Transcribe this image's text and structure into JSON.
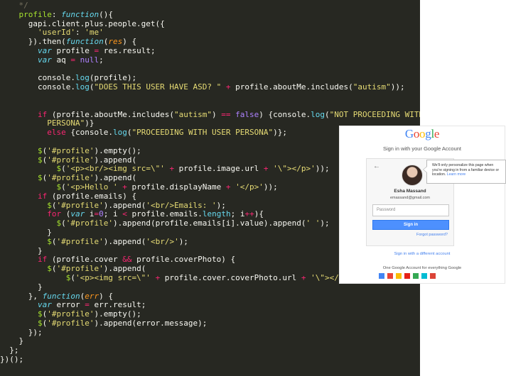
{
  "editor": {
    "lines": [
      [
        {
          "t": "    */",
          "c": "c"
        }
      ],
      [
        {
          "t": "    ",
          "c": ""
        },
        {
          "t": "profile",
          "c": "fn"
        },
        {
          "t": ": ",
          "c": ""
        },
        {
          "t": "function",
          "c": "f"
        },
        {
          "t": "(){",
          "c": ""
        }
      ],
      [
        {
          "t": "      gapi.client.plus.people.get({",
          "c": ""
        }
      ],
      [
        {
          "t": "        ",
          "c": ""
        },
        {
          "t": "'userId'",
          "c": "s"
        },
        {
          "t": ": ",
          "c": ""
        },
        {
          "t": "'me'",
          "c": "s"
        }
      ],
      [
        {
          "t": "      }).then(",
          "c": ""
        },
        {
          "t": "function",
          "c": "f"
        },
        {
          "t": "(",
          "c": ""
        },
        {
          "t": "res",
          "c": "p"
        },
        {
          "t": ") {",
          "c": ""
        }
      ],
      [
        {
          "t": "        ",
          "c": ""
        },
        {
          "t": "var",
          "c": "f"
        },
        {
          "t": " profile ",
          "c": ""
        },
        {
          "t": "=",
          "c": "k"
        },
        {
          "t": " res.result;",
          "c": ""
        }
      ],
      [
        {
          "t": "        ",
          "c": ""
        },
        {
          "t": "var",
          "c": "f"
        },
        {
          "t": " aq ",
          "c": ""
        },
        {
          "t": "=",
          "c": "k"
        },
        {
          "t": " ",
          "c": ""
        },
        {
          "t": "null",
          "c": "n"
        },
        {
          "t": ";",
          "c": ""
        }
      ],
      [
        {
          "t": "",
          "c": ""
        }
      ],
      [
        {
          "t": "        console.",
          "c": ""
        },
        {
          "t": "log",
          "c": "b"
        },
        {
          "t": "(profile);",
          "c": ""
        }
      ],
      [
        {
          "t": "        console.",
          "c": ""
        },
        {
          "t": "log",
          "c": "b"
        },
        {
          "t": "(",
          "c": ""
        },
        {
          "t": "\"DOES THIS USER HAVE ASD? \"",
          "c": "s"
        },
        {
          "t": " ",
          "c": ""
        },
        {
          "t": "+",
          "c": "k"
        },
        {
          "t": " profile.aboutMe.includes(",
          "c": ""
        },
        {
          "t": "\"autism\"",
          "c": "s"
        },
        {
          "t": "));",
          "c": ""
        }
      ],
      [
        {
          "t": "",
          "c": ""
        }
      ],
      [
        {
          "t": "",
          "c": ""
        }
      ],
      [
        {
          "t": "        ",
          "c": ""
        },
        {
          "t": "if",
          "c": "k"
        },
        {
          "t": " (profile.aboutMe.includes(",
          "c": ""
        },
        {
          "t": "\"autism\"",
          "c": "s"
        },
        {
          "t": ") ",
          "c": ""
        },
        {
          "t": "==",
          "c": "k"
        },
        {
          "t": " ",
          "c": ""
        },
        {
          "t": "false",
          "c": "n"
        },
        {
          "t": ") {console.",
          "c": ""
        },
        {
          "t": "log",
          "c": "b"
        },
        {
          "t": "(",
          "c": ""
        },
        {
          "t": "\"NOT PROCEEDING WITH USER",
          "c": "s"
        }
      ],
      [
        {
          "t": "          ",
          "c": ""
        },
        {
          "t": "PERSONA\"",
          "c": "s"
        },
        {
          "t": ")}",
          "c": ""
        }
      ],
      [
        {
          "t": "          ",
          "c": ""
        },
        {
          "t": "else",
          "c": "k"
        },
        {
          "t": " {console.",
          "c": ""
        },
        {
          "t": "log",
          "c": "b"
        },
        {
          "t": "(",
          "c": ""
        },
        {
          "t": "\"PROCEEDING WITH USER PERSONA\"",
          "c": "s"
        },
        {
          "t": ")};",
          "c": ""
        }
      ],
      [
        {
          "t": "",
          "c": ""
        }
      ],
      [
        {
          "t": "        ",
          "c": ""
        },
        {
          "t": "$",
          "c": "fn"
        },
        {
          "t": "(",
          "c": ""
        },
        {
          "t": "'#profile'",
          "c": "s"
        },
        {
          "t": ").empty();",
          "c": ""
        }
      ],
      [
        {
          "t": "        ",
          "c": ""
        },
        {
          "t": "$",
          "c": "fn"
        },
        {
          "t": "(",
          "c": ""
        },
        {
          "t": "'#profile'",
          "c": "s"
        },
        {
          "t": ").append(",
          "c": ""
        }
      ],
      [
        {
          "t": "            ",
          "c": ""
        },
        {
          "t": "$",
          "c": "fn"
        },
        {
          "t": "(",
          "c": ""
        },
        {
          "t": "'<p><br/><img src=\\\"'",
          "c": "s"
        },
        {
          "t": " ",
          "c": ""
        },
        {
          "t": "+",
          "c": "k"
        },
        {
          "t": " profile.image.url ",
          "c": ""
        },
        {
          "t": "+",
          "c": "k"
        },
        {
          "t": " ",
          "c": ""
        },
        {
          "t": "'\\\"></p>'",
          "c": "s"
        },
        {
          "t": "));",
          "c": ""
        }
      ],
      [
        {
          "t": "        ",
          "c": ""
        },
        {
          "t": "$",
          "c": "fn"
        },
        {
          "t": "(",
          "c": ""
        },
        {
          "t": "'#profile'",
          "c": "s"
        },
        {
          "t": ").append(",
          "c": ""
        }
      ],
      [
        {
          "t": "            ",
          "c": ""
        },
        {
          "t": "$",
          "c": "fn"
        },
        {
          "t": "(",
          "c": ""
        },
        {
          "t": "'<p>Hello '",
          "c": "s"
        },
        {
          "t": " ",
          "c": ""
        },
        {
          "t": "+",
          "c": "k"
        },
        {
          "t": " profile.displayName ",
          "c": ""
        },
        {
          "t": "+",
          "c": "k"
        },
        {
          "t": " ",
          "c": ""
        },
        {
          "t": "'</p>'",
          "c": "s"
        },
        {
          "t": "));",
          "c": ""
        }
      ],
      [
        {
          "t": "        ",
          "c": ""
        },
        {
          "t": "if",
          "c": "k"
        },
        {
          "t": " (profile.emails) {",
          "c": ""
        }
      ],
      [
        {
          "t": "          ",
          "c": ""
        },
        {
          "t": "$",
          "c": "fn"
        },
        {
          "t": "(",
          "c": ""
        },
        {
          "t": "'#profile'",
          "c": "s"
        },
        {
          "t": ").append(",
          "c": ""
        },
        {
          "t": "'<br/>Emails: '",
          "c": "s"
        },
        {
          "t": ");",
          "c": ""
        }
      ],
      [
        {
          "t": "          ",
          "c": ""
        },
        {
          "t": "for",
          "c": "k"
        },
        {
          "t": " (",
          "c": ""
        },
        {
          "t": "var",
          "c": "f"
        },
        {
          "t": " i",
          "c": ""
        },
        {
          "t": "=",
          "c": "k"
        },
        {
          "t": "0",
          "c": "n"
        },
        {
          "t": "; i ",
          "c": ""
        },
        {
          "t": "<",
          "c": "k"
        },
        {
          "t": " profile.emails.",
          "c": ""
        },
        {
          "t": "length",
          "c": "b"
        },
        {
          "t": "; i",
          "c": ""
        },
        {
          "t": "++",
          "c": "k"
        },
        {
          "t": "){",
          "c": ""
        }
      ],
      [
        {
          "t": "            ",
          "c": ""
        },
        {
          "t": "$",
          "c": "fn"
        },
        {
          "t": "(",
          "c": ""
        },
        {
          "t": "'#profile'",
          "c": "s"
        },
        {
          "t": ").append(profile.emails[i].value).append(",
          "c": ""
        },
        {
          "t": "' '",
          "c": "s"
        },
        {
          "t": ");",
          "c": ""
        }
      ],
      [
        {
          "t": "          }",
          "c": ""
        }
      ],
      [
        {
          "t": "          ",
          "c": ""
        },
        {
          "t": "$",
          "c": "fn"
        },
        {
          "t": "(",
          "c": ""
        },
        {
          "t": "'#profile'",
          "c": "s"
        },
        {
          "t": ").append(",
          "c": ""
        },
        {
          "t": "'<br/>'",
          "c": "s"
        },
        {
          "t": ");",
          "c": ""
        }
      ],
      [
        {
          "t": "        }",
          "c": ""
        }
      ],
      [
        {
          "t": "        ",
          "c": ""
        },
        {
          "t": "if",
          "c": "k"
        },
        {
          "t": " (profile.cover ",
          "c": ""
        },
        {
          "t": "&&",
          "c": "k"
        },
        {
          "t": " profile.coverPhoto) {",
          "c": ""
        }
      ],
      [
        {
          "t": "          ",
          "c": ""
        },
        {
          "t": "$",
          "c": "fn"
        },
        {
          "t": "(",
          "c": ""
        },
        {
          "t": "'#profile'",
          "c": "s"
        },
        {
          "t": ").append(",
          "c": ""
        }
      ],
      [
        {
          "t": "              ",
          "c": ""
        },
        {
          "t": "$",
          "c": "fn"
        },
        {
          "t": "(",
          "c": ""
        },
        {
          "t": "'<p><img src=\\\"'",
          "c": "s"
        },
        {
          "t": " ",
          "c": ""
        },
        {
          "t": "+",
          "c": "k"
        },
        {
          "t": " profile.cover.coverPhoto.url ",
          "c": ""
        },
        {
          "t": "+",
          "c": "k"
        },
        {
          "t": " ",
          "c": ""
        },
        {
          "t": "'\\\"></p>'",
          "c": "s"
        },
        {
          "t": "));",
          "c": ""
        }
      ],
      [
        {
          "t": "        }",
          "c": ""
        }
      ],
      [
        {
          "t": "      }, ",
          "c": ""
        },
        {
          "t": "function",
          "c": "f"
        },
        {
          "t": "(",
          "c": ""
        },
        {
          "t": "err",
          "c": "p"
        },
        {
          "t": ") {",
          "c": ""
        }
      ],
      [
        {
          "t": "        ",
          "c": ""
        },
        {
          "t": "var",
          "c": "f"
        },
        {
          "t": " error ",
          "c": ""
        },
        {
          "t": "=",
          "c": "k"
        },
        {
          "t": " err.result;",
          "c": ""
        }
      ],
      [
        {
          "t": "        ",
          "c": ""
        },
        {
          "t": "$",
          "c": "fn"
        },
        {
          "t": "(",
          "c": ""
        },
        {
          "t": "'#profile'",
          "c": "s"
        },
        {
          "t": ").empty();",
          "c": ""
        }
      ],
      [
        {
          "t": "        ",
          "c": ""
        },
        {
          "t": "$",
          "c": "fn"
        },
        {
          "t": "(",
          "c": ""
        },
        {
          "t": "'#profile'",
          "c": "s"
        },
        {
          "t": ").append(error.message);",
          "c": ""
        }
      ],
      [
        {
          "t": "      });",
          "c": ""
        }
      ],
      [
        {
          "t": "    }",
          "c": ""
        }
      ],
      [
        {
          "t": "  };",
          "c": ""
        }
      ],
      [
        {
          "t": "})();",
          "c": ""
        }
      ]
    ]
  },
  "google_signin": {
    "logo_letters": [
      {
        "ch": "G",
        "color": "#4285f4"
      },
      {
        "ch": "o",
        "color": "#ea4335"
      },
      {
        "ch": "o",
        "color": "#fbbc05"
      },
      {
        "ch": "g",
        "color": "#4285f4"
      },
      {
        "ch": "l",
        "color": "#34a853"
      },
      {
        "ch": "e",
        "color": "#ea4335"
      }
    ],
    "subtitle": "Sign in with your Google Account",
    "back_icon": "←",
    "user_name": "Esha Massand",
    "user_email": "emassand@gmail.com",
    "password_placeholder": "Password",
    "sign_in_label": "Sign in",
    "forgot_password": "Forgot password?",
    "tooltip_text": "We'll only personalize this page when you're signing in from a familiar device or location.",
    "tooltip_link": "Learn more",
    "different_account": "Sign in with a different account",
    "one_account_text": "One Google Account for everything Google",
    "app_icons": [
      {
        "name": "google-search-icon",
        "color": "#4285f4"
      },
      {
        "name": "gmail-icon",
        "color": "#ea4335"
      },
      {
        "name": "drive-icon",
        "color": "#fbbc05"
      },
      {
        "name": "youtube-icon",
        "color": "#e62117"
      },
      {
        "name": "maps-icon",
        "color": "#34a853"
      },
      {
        "name": "play-icon",
        "color": "#00bcd4"
      },
      {
        "name": "chrome-icon",
        "color": "#db4437"
      }
    ]
  }
}
